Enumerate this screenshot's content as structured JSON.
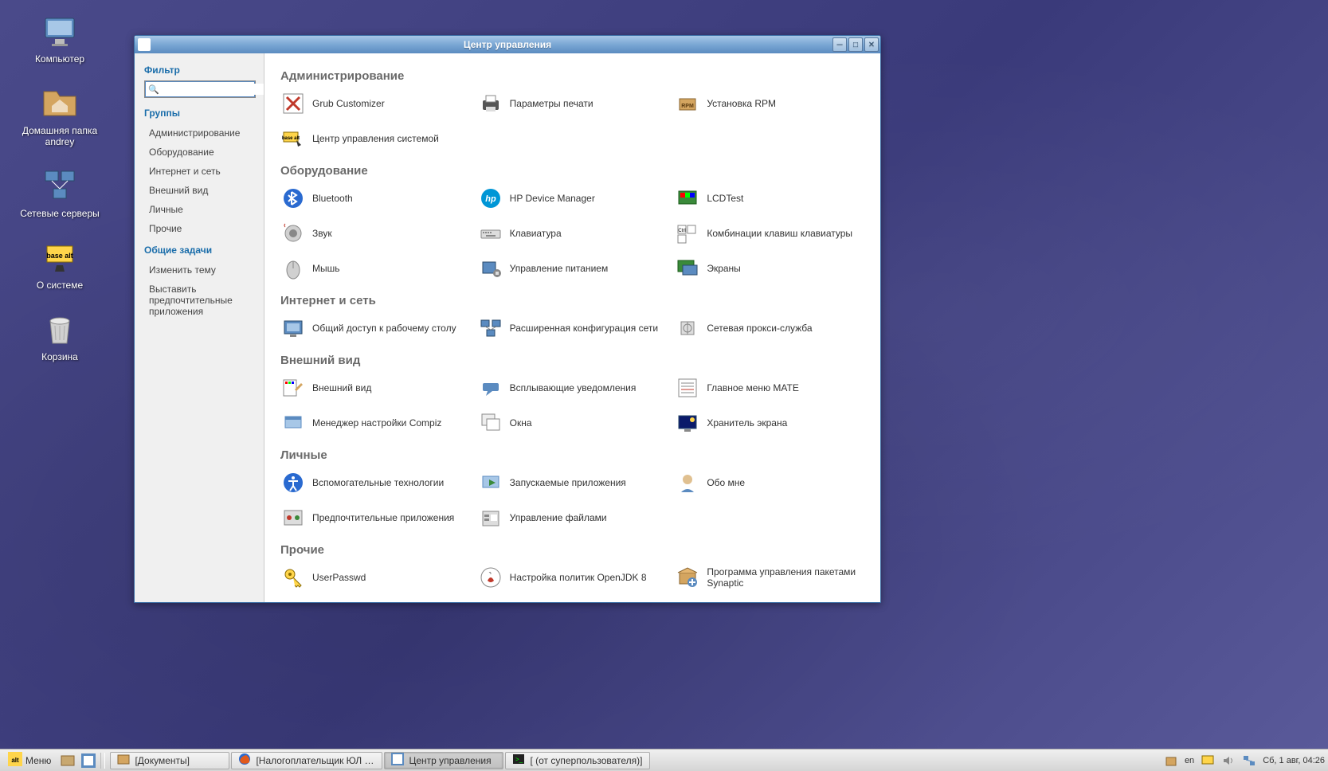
{
  "desktop": {
    "icons": [
      {
        "id": "computer",
        "label": "Компьютер"
      },
      {
        "id": "home",
        "label": "Домашняя папка andrey"
      },
      {
        "id": "net-servers",
        "label": "Сетевые серверы"
      },
      {
        "id": "about",
        "label": "О системе"
      },
      {
        "id": "trash",
        "label": "Корзина"
      }
    ]
  },
  "window": {
    "title": "Центр управления",
    "sidebar": {
      "filter_heading": "Фильтр",
      "search_placeholder": "",
      "groups_heading": "Группы",
      "groups": [
        "Администрирование",
        "Оборудование",
        "Интернет и сеть",
        "Внешний вид",
        "Личные",
        "Прочие"
      ],
      "tasks_heading": "Общие задачи",
      "tasks": [
        "Изменить тему",
        "Выставить предпочтительные приложения"
      ]
    },
    "sections": [
      {
        "title": "Администрирование",
        "items": [
          {
            "icon": "grub",
            "label": "Grub Customizer"
          },
          {
            "icon": "printer",
            "label": "Параметры печати"
          },
          {
            "icon": "rpm",
            "label": "Установка RPM"
          },
          {
            "icon": "alt-center",
            "label": "Центр управления системой"
          }
        ]
      },
      {
        "title": "Оборудование",
        "items": [
          {
            "icon": "bluetooth",
            "label": "Bluetooth"
          },
          {
            "icon": "hp",
            "label": "HP Device Manager"
          },
          {
            "icon": "lcd",
            "label": "LCDTest"
          },
          {
            "icon": "sound",
            "label": "Звук"
          },
          {
            "icon": "keyboard",
            "label": "Клавиатура"
          },
          {
            "icon": "shortcuts",
            "label": "Комбинации клавиш клавиатуры"
          },
          {
            "icon": "mouse",
            "label": "Мышь"
          },
          {
            "icon": "power",
            "label": "Управление питанием"
          },
          {
            "icon": "displays",
            "label": "Экраны"
          }
        ]
      },
      {
        "title": "Интернет и сеть",
        "items": [
          {
            "icon": "sharing",
            "label": "Общий доступ к рабочему столу"
          },
          {
            "icon": "netconf",
            "label": "Расширенная конфигурация сети"
          },
          {
            "icon": "proxy",
            "label": "Сетевая прокси-служба"
          }
        ]
      },
      {
        "title": "Внешний вид",
        "items": [
          {
            "icon": "appearance",
            "label": "Внешний вид"
          },
          {
            "icon": "notify",
            "label": "Всплывающие уведомления"
          },
          {
            "icon": "mate-menu",
            "label": "Главное меню MATE"
          },
          {
            "icon": "compiz",
            "label": "Менеджер настройки Compiz"
          },
          {
            "icon": "windows",
            "label": "Окна"
          },
          {
            "icon": "screensaver",
            "label": "Хранитель экрана"
          }
        ]
      },
      {
        "title": "Личные",
        "items": [
          {
            "icon": "a11y",
            "label": "Вспомогательные технологии"
          },
          {
            "icon": "startup",
            "label": "Запускаемые приложения"
          },
          {
            "icon": "about-me",
            "label": "Обо мне"
          },
          {
            "icon": "pref-apps",
            "label": "Предпочтительные приложения"
          },
          {
            "icon": "filemgr",
            "label": "Управление файлами"
          }
        ]
      },
      {
        "title": "Прочие",
        "items": [
          {
            "icon": "userpasswd",
            "label": "UserPasswd"
          },
          {
            "icon": "openjdk",
            "label": "Настройка политик OpenJDK 8"
          },
          {
            "icon": "synaptic",
            "label": "Программа управления пакетами Synaptic"
          }
        ]
      }
    ]
  },
  "taskbar": {
    "menu_label": "Меню",
    "windows": [
      {
        "icon": "filemgr-task",
        "label": "[Документы]"
      },
      {
        "icon": "firefox",
        "label": "[Налогоплательщик ЮЛ | ..."
      },
      {
        "icon": "control",
        "label": "Центр управления"
      },
      {
        "icon": "terminal",
        "label": "[ (от суперпользователя)]"
      }
    ],
    "tray": {
      "lang": "en",
      "clock": "Сб, 1 авг, 04:26"
    }
  }
}
